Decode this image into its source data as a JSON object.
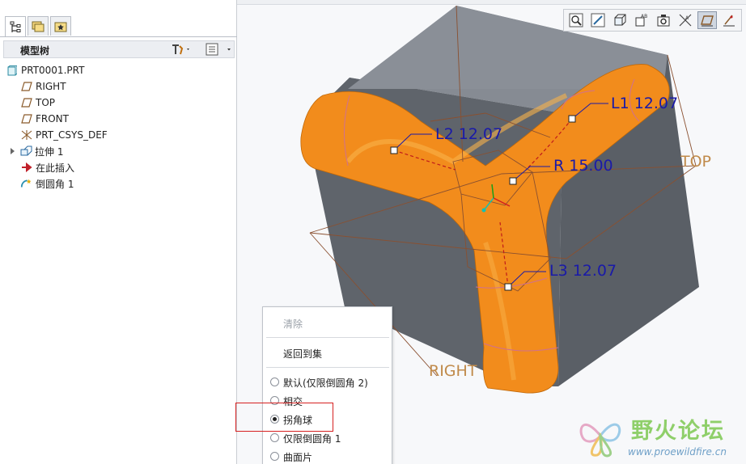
{
  "tree": {
    "header_title": "模型树",
    "items": [
      {
        "label": "PRT0001.PRT",
        "icon": "part-icon"
      },
      {
        "label": "RIGHT",
        "icon": "datum-plane-icon"
      },
      {
        "label": "TOP",
        "icon": "datum-plane-icon"
      },
      {
        "label": "FRONT",
        "icon": "datum-plane-icon"
      },
      {
        "label": "PRT_CSYS_DEF",
        "icon": "csys-icon"
      },
      {
        "label": "拉伸 1",
        "icon": "extrude-icon"
      },
      {
        "label": "在此插入",
        "icon": "insert-here-arrow-icon"
      },
      {
        "label": "倒圆角 1",
        "icon": "round-icon"
      }
    ]
  },
  "viewport": {
    "dimensions": {
      "l1": "L1 12.07",
      "l2": "L2 12.07",
      "l3": "L3 12.07",
      "r": "R 15.00"
    },
    "planes": {
      "top": "TOP",
      "right": "RIGHT"
    },
    "colors": {
      "round_orange": "#f28c1c",
      "cube_dark": "#5b6067",
      "cube_top": "#868b93",
      "dimension_blue": "#1a1aa8",
      "datum_brown": "#b07a3a"
    }
  },
  "context_menu": {
    "clear": "清除",
    "back_to_set": "返回到集",
    "options": [
      {
        "label": "默认(仅限倒圆角 2)",
        "selected": false
      },
      {
        "label": "相交",
        "selected": false
      },
      {
        "label": "拐角球",
        "selected": true
      },
      {
        "label": "仅限倒圆角 1",
        "selected": false
      },
      {
        "label": "曲面片",
        "selected": false
      }
    ]
  },
  "watermark": {
    "name": "野火论坛",
    "url": "www.proewildfire.cn"
  }
}
